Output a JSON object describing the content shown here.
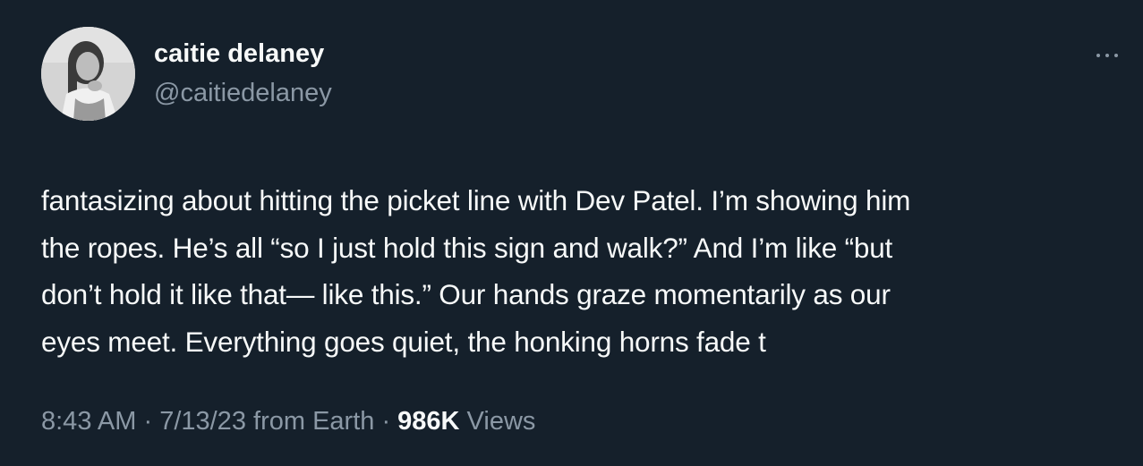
{
  "author": {
    "display_name": "caitie delaney",
    "handle": "@caitiedelaney",
    "avatar_icon": "profile-photo"
  },
  "more_icon": "more-horizontal-icon",
  "tweet": {
    "lines": [
      "fantasizing about hitting the picket line with Dev Patel. I’m showing him",
      "the ropes. He’s all “so I just hold this sign and walk?” And I’m like “but",
      "don’t hold it like that— like this.” Our hands graze momentarily as our",
      "eyes meet. Everything goes quiet, the honking horns fade t"
    ]
  },
  "meta": {
    "time": "8:43 AM",
    "sep1": " · ",
    "date": "7/13/23",
    "source": " from Earth",
    "sep2": " · ",
    "views_count": "986K",
    "views_label": " Views"
  },
  "colors": {
    "background": "#15202b",
    "primary_text": "#f7f9f9",
    "secondary_text": "#8b98a5"
  }
}
